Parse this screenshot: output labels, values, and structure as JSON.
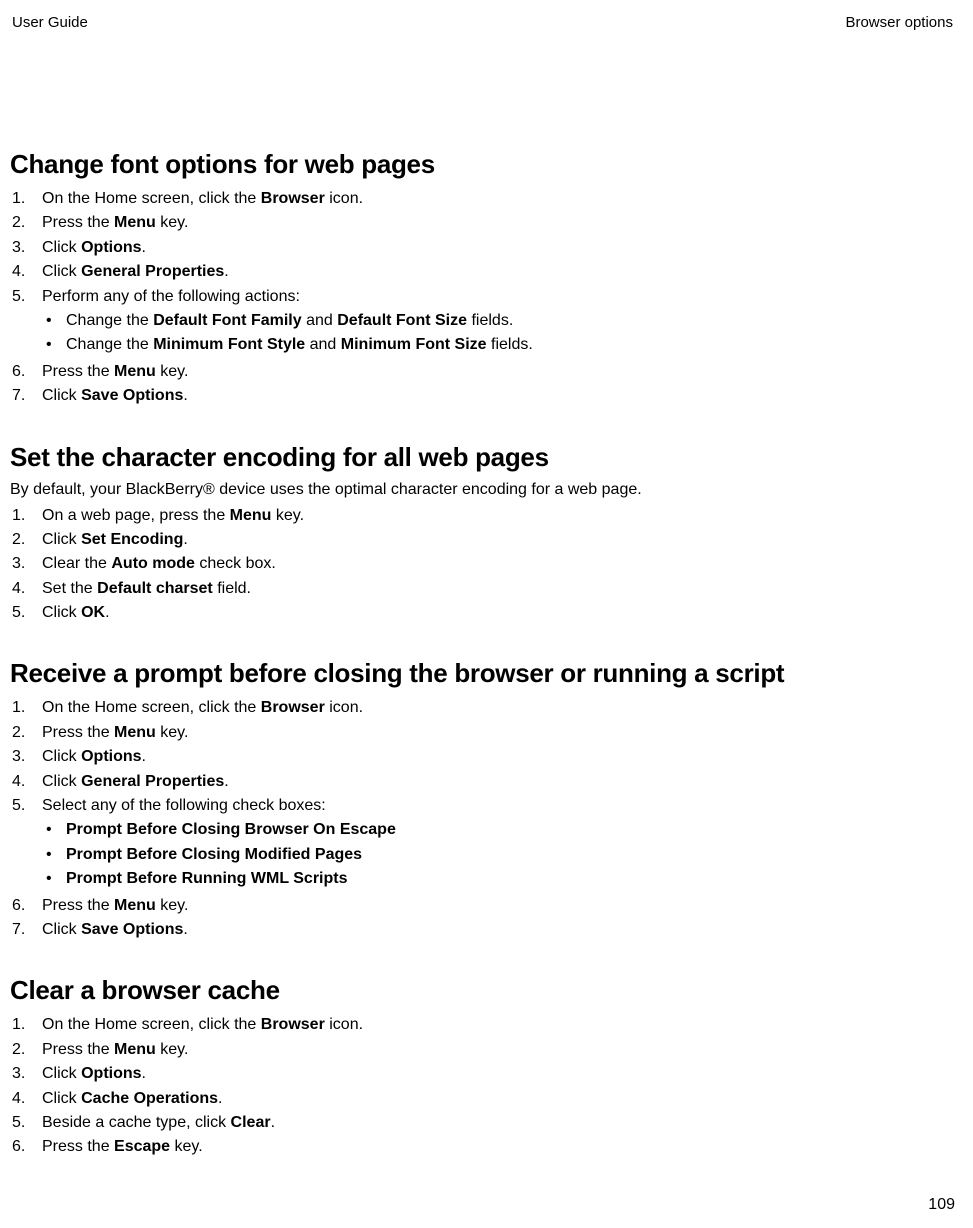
{
  "header": {
    "left": "User Guide",
    "right": "Browser options"
  },
  "page_number": "109",
  "sections": [
    {
      "title": "Change font options for web pages",
      "intro": "",
      "steps": [
        {
          "n": "1.",
          "t": "On the Home screen, click the ",
          "b1": "Browser",
          "t2": " icon."
        },
        {
          "n": "2.",
          "t": "Press the ",
          "b1": "Menu",
          "t2": " key."
        },
        {
          "n": "3.",
          "t": "Click ",
          "b1": "Options",
          "t2": "."
        },
        {
          "n": "4.",
          "t": "Click ",
          "b1": "General Properties",
          "t2": "."
        },
        {
          "n": "5.",
          "t": "Perform any of the following actions:",
          "sub": [
            {
              "t": "Change the ",
              "b1": "Default Font Family",
              "t2": " and ",
              "b2": "Default Font Size",
              "t3": " fields."
            },
            {
              "t": "Change the ",
              "b1": "Minimum Font Style",
              "t2": " and ",
              "b2": "Minimum Font Size",
              "t3": " fields."
            }
          ]
        },
        {
          "n": "6.",
          "t": "Press the ",
          "b1": "Menu",
          "t2": " key."
        },
        {
          "n": "7.",
          "t": "Click ",
          "b1": "Save Options",
          "t2": "."
        }
      ]
    },
    {
      "title": "Set the character encoding for all web pages",
      "intro": "By default, your BlackBerry® device uses the optimal character encoding for a web page.",
      "steps": [
        {
          "n": "1.",
          "t": "On a web page, press the ",
          "b1": "Menu",
          "t2": " key."
        },
        {
          "n": "2.",
          "t": "Click ",
          "b1": "Set Encoding",
          "t2": "."
        },
        {
          "n": "3.",
          "t": "Clear the ",
          "b1": "Auto mode",
          "t2": " check box."
        },
        {
          "n": "4.",
          "t": "Set the ",
          "b1": "Default charset",
          "t2": " field."
        },
        {
          "n": "5.",
          "t": "Click ",
          "b1": "OK",
          "t2": "."
        }
      ]
    },
    {
      "title": "Receive a prompt before closing the browser or running a script",
      "intro": "",
      "steps": [
        {
          "n": "1.",
          "t": "On the Home screen, click the ",
          "b1": "Browser",
          "t2": " icon."
        },
        {
          "n": "2.",
          "t": "Press the ",
          "b1": "Menu",
          "t2": " key."
        },
        {
          "n": "3.",
          "t": "Click ",
          "b1": "Options",
          "t2": "."
        },
        {
          "n": "4.",
          "t": "Click ",
          "b1": "General Properties",
          "t2": "."
        },
        {
          "n": "5.",
          "t": "Select any of the following check boxes:",
          "sub": [
            {
              "b1": "Prompt Before Closing Browser On Escape"
            },
            {
              "b1": "Prompt Before Closing Modified Pages"
            },
            {
              "b1": "Prompt Before Running WML Scripts"
            }
          ]
        },
        {
          "n": "6.",
          "t": "Press the ",
          "b1": "Menu",
          "t2": " key."
        },
        {
          "n": "7.",
          "t": "Click ",
          "b1": "Save Options",
          "t2": "."
        }
      ]
    },
    {
      "title": "Clear a browser cache",
      "intro": "",
      "steps": [
        {
          "n": "1.",
          "t": "On the Home screen, click the ",
          "b1": "Browser",
          "t2": " icon."
        },
        {
          "n": "2.",
          "t": "Press the ",
          "b1": "Menu",
          "t2": " key."
        },
        {
          "n": "3.",
          "t": "Click ",
          "b1": "Options",
          "t2": "."
        },
        {
          "n": "4.",
          "t": "Click ",
          "b1": "Cache Operations",
          "t2": "."
        },
        {
          "n": "5.",
          "t": "Beside a cache type, click ",
          "b1": "Clear",
          "t2": "."
        },
        {
          "n": "6.",
          "t": "Press the ",
          "b1": "Escape",
          "t2": " key."
        }
      ]
    }
  ]
}
